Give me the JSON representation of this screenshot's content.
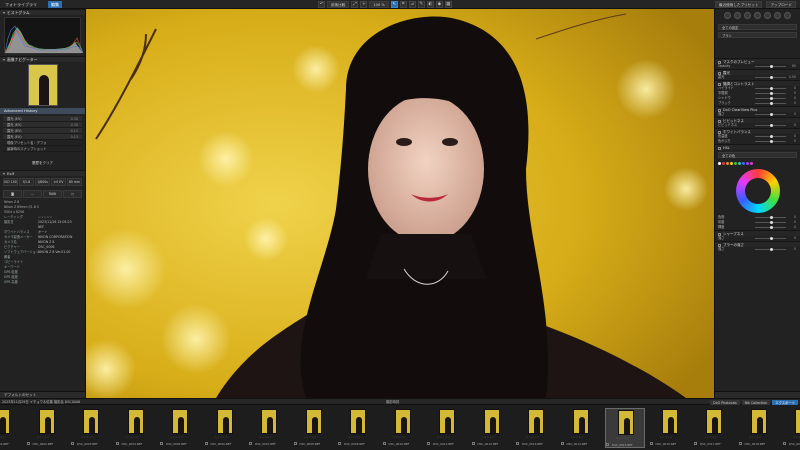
{
  "topbar": {
    "tabs": [
      {
        "label": "フォトライブラリ",
        "active": false
      },
      {
        "label": "編集",
        "active": true
      }
    ],
    "tools": [
      "前後比較",
      "100 %"
    ],
    "right": [
      "最近使用したプリセット",
      "アップロード"
    ]
  },
  "left_panel": {
    "histogram": {
      "title": "ヒストグラム",
      "colors": [
        "#e04848",
        "#48c048",
        "#4878e0"
      ]
    },
    "navigator": {
      "title": "画像ナビゲーター"
    },
    "advanced_history": {
      "title": "Advanced History",
      "rows": [
        {
          "label": "露光 (EV)",
          "value": "0.30"
        },
        {
          "label": "露光 (EV)",
          "value": "0.30"
        },
        {
          "label": "露光 (EV)",
          "value": "0.13"
        },
        {
          "label": "露光 (EV)",
          "value": "0.13"
        }
      ],
      "extra": [
        "現像プリセット名：デフォ",
        "最新時のスナップショット"
      ]
    },
    "snapshot_button": "履歴をクリア",
    "exif": {
      "title": "Exif",
      "cells_row1": [
        "ISO 100",
        "f/1.8",
        "1/800s",
        "±0 EV",
        "85 mm"
      ],
      "cells_row2": [
        "",
        "",
        "RAW",
        ""
      ],
      "lines": [
        "Nikon Z 8",
        "Nikon Z 85mm f/1.8 S",
        "5504 x 8256"
      ],
      "rows": [
        {
          "k": "レーティング",
          "v": "☆☆☆☆☆"
        },
        {
          "k": "撮影日",
          "v": "2023/11/26 15:05:23"
        },
        {
          "k": "",
          "v": "NEF"
        },
        {
          "k": "ホワイトバランス",
          "v": "オート"
        },
        {
          "k": "カメラ製造メーカー",
          "v": "NIKON CORPORATION"
        },
        {
          "k": "カメラ名",
          "v": "NIKON Z 8"
        },
        {
          "k": "ピクチャー",
          "v": "DSC_0006"
        },
        {
          "k": "ソフトウェアバージョン",
          "v": "NIKON Z 8 Ver.01.00"
        },
        {
          "k": "著者",
          "v": ""
        },
        {
          "k": "コピーライト",
          "v": ""
        },
        {
          "k": "キーワード",
          "v": ""
        },
        {
          "k": "GPS 緯度",
          "v": ""
        },
        {
          "k": "GPS 経度",
          "v": ""
        },
        {
          "k": "GPS 高度",
          "v": ""
        }
      ]
    },
    "bottom": "デフォルトのセット"
  },
  "right_panel": {
    "mode": "全ての設定",
    "brush": "ブラシ",
    "sections": [
      {
        "title": "マスクのプレビュー",
        "rows": [
          {
            "label": "Opacity",
            "value": "60"
          }
        ]
      },
      {
        "title": "露光",
        "rows": [
          {
            "label": "露光",
            "value": "0.00"
          }
        ]
      },
      {
        "title": "階調とコントラスト",
        "rows": [
          {
            "label": "ハイライト",
            "value": "0"
          },
          {
            "label": "中間調",
            "value": "0"
          },
          {
            "label": "シャドウ",
            "value": "0"
          },
          {
            "label": "ブラック",
            "value": "0"
          }
        ]
      },
      {
        "title": "DxO ClearView Plus",
        "rows": [
          {
            "label": "強さ",
            "value": "0"
          }
        ]
      },
      {
        "title": "ビビッドネス",
        "rows": [
          {
            "label": "ビビッドネス",
            "value": "0"
          }
        ]
      },
      {
        "title": "ホワイトバランス",
        "rows": [
          {
            "label": "色温度",
            "value": "0"
          },
          {
            "label": "色かぶり",
            "value": "0"
          }
        ]
      },
      {
        "title": "HSL",
        "rows": []
      }
    ],
    "hsl_select": "全ての色",
    "swatches": [
      "#ffffff",
      "#e03b3b",
      "#f08a2a",
      "#f0d020",
      "#3fc03f",
      "#2ac0c0",
      "#3b6bff",
      "#a03bff",
      "#e03bd0"
    ],
    "hsl_rows": [
      {
        "label": "色相",
        "value": "0"
      },
      {
        "label": "彩度",
        "value": "0"
      },
      {
        "label": "輝度",
        "value": "0"
      }
    ],
    "bottom_sections": [
      {
        "title": "シャープネス",
        "rows": [
          {
            "label": "強さ",
            "value": "0"
          }
        ]
      },
      {
        "title": "ブラーの強さ",
        "rows": [
          {
            "label": "強さ",
            "value": "0"
          }
        ]
      }
    ]
  },
  "filmstrip": {
    "path": "2023年11月29日 イチョウ＆紅葉 撮影会 DSC0006",
    "sort": "撮影時刻",
    "buttons": [
      {
        "label": "DxO PhotoLab",
        "active": false
      },
      {
        "label": "Nik Collection",
        "active": false
      },
      {
        "label": "エクスポート",
        "active": true
      }
    ],
    "thumbs": [
      "DSC_0001.NEF",
      "DSC_0002.NEF",
      "DSC_0003.NEF",
      "DSC_0004.NEF",
      "DSC_0005.NEF",
      "DSC_0006.NEF",
      "DSC_0007.NEF",
      "DSC_0008.NEF",
      "DSC_0009.NEF",
      "DSC_0010.NEF",
      "DSC_0011.NEF",
      "DSC_0012.NEF",
      "DSC_0013.NEF",
      "DSC_0014.NEF",
      "DSC_0015.NEF",
      "DSC_0016.NEF",
      "DSC_0017.NEF",
      "DSC_0018.NEF",
      "DSC_0019.NEF",
      "DSC_0020.NEF"
    ],
    "selected_index": 14,
    "rating": "☆☆☆☆☆"
  }
}
